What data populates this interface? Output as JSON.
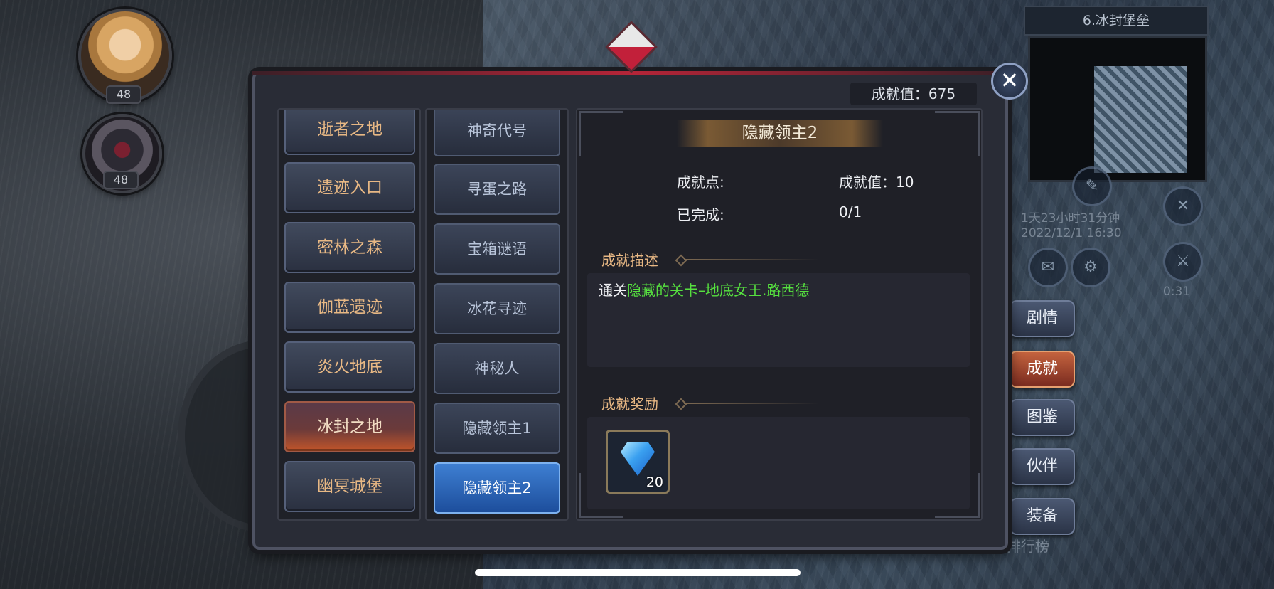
{
  "player": {
    "avatars": [
      {
        "level": "48"
      },
      {
        "level": "48"
      }
    ]
  },
  "map": {
    "title": "6.冰封堡垒"
  },
  "hud": {
    "timer_text": "1天23小时31分钟",
    "date_text": "2022/12/1 16:30",
    "countdown": "0:31",
    "leaderboard": "排行榜"
  },
  "side_menu": [
    {
      "label": "剧情"
    },
    {
      "label": "成就",
      "active": true
    },
    {
      "label": "图鉴"
    },
    {
      "label": "伙伴"
    },
    {
      "label": "装备"
    }
  ],
  "panel": {
    "score_label": "成就值：675",
    "areas": [
      {
        "label": "逝者之地"
      },
      {
        "label": "遗迹入口"
      },
      {
        "label": "密林之森"
      },
      {
        "label": "伽蓝遗迹"
      },
      {
        "label": "炎火地底"
      },
      {
        "label": "冰封之地",
        "selected": true
      },
      {
        "label": "幽冥城堡"
      }
    ],
    "achievements": [
      {
        "label": "神奇代号"
      },
      {
        "label": "寻蛋之路"
      },
      {
        "label": "宝箱谜语"
      },
      {
        "label": "冰花寻迹"
      },
      {
        "label": "神秘人"
      },
      {
        "label": "隐藏领主1"
      },
      {
        "label": "隐藏领主2",
        "selected": true
      }
    ],
    "detail": {
      "title": "隐藏领主2",
      "points_label": "成就点:",
      "value_label": "成就值：10",
      "completed_label": "已完成:",
      "completed_value": "0/1",
      "desc_heading": "成就描述",
      "desc_prefix": "通关",
      "desc_highlight": "隐藏的关卡–地底女王.路西德",
      "reward_heading": "成就奖励",
      "reward": {
        "icon": "diamond-gem-icon",
        "count": "20"
      }
    }
  },
  "colors": {
    "accent_gold": "#e8b884",
    "highlight_green": "#56e03f",
    "selected_blue": "#3e7fd2",
    "selected_area": "#c2552a"
  }
}
